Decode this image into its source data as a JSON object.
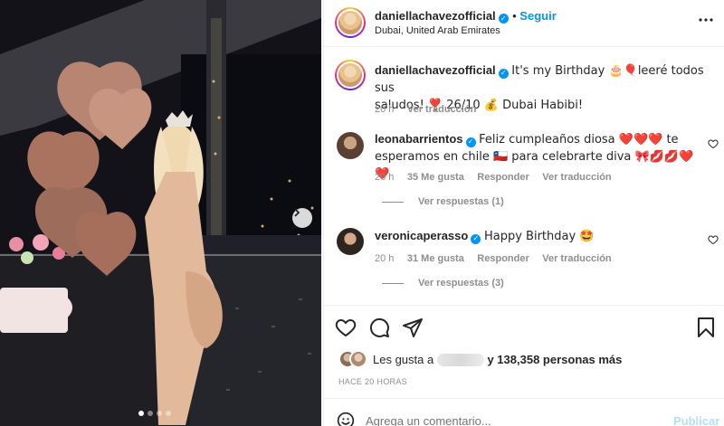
{
  "post": {
    "username": "daniellachavezofficial",
    "follow_label": "Seguir",
    "location": "Dubai, United Arab Emirates",
    "more_icon": "more-horizontal-icon"
  },
  "media": {
    "image_count": 4,
    "active_index": 0
  },
  "caption": {
    "username": "daniellachavezofficial",
    "text_line1": "It's my Birthday 🎂🎈leeré todos sus",
    "text_line2": "saludos! ❣️ 26/10 💰 Dubai Habibi!",
    "time": "20 h",
    "translate": "Ver traducción"
  },
  "comments": [
    {
      "username": "leonabarrientos",
      "text_line1": "Feliz cumpleaños diosa ❤️❤️❤️ te",
      "text_line2": "esperamos en chile 🇨🇱 para celebrarte diva 🎀💋💋❤️❤️",
      "time": "20 h",
      "likes": "35 Me gusta",
      "reply": "Responder",
      "translate": "Ver traducción",
      "view_replies": "Ver respuestas (1)"
    },
    {
      "username": "veronicaperasso",
      "text_line1": "Happy Birthday 🤩",
      "time": "20 h",
      "likes": "31 Me gusta",
      "reply": "Responder",
      "translate": "Ver traducción",
      "view_replies": "Ver respuestas (3)"
    }
  ],
  "likes": {
    "prefix": "Les gusta a",
    "suffix": "y 138,358 personas más"
  },
  "timestamp": "HACE 20 HORAS",
  "comment_box": {
    "placeholder": "Agrega un comentario...",
    "publish": "Publicar"
  },
  "colors": {
    "accent": "#0095f6",
    "verified": "#0095f6",
    "muted": "#8e8e8e",
    "border": "#efefef"
  }
}
